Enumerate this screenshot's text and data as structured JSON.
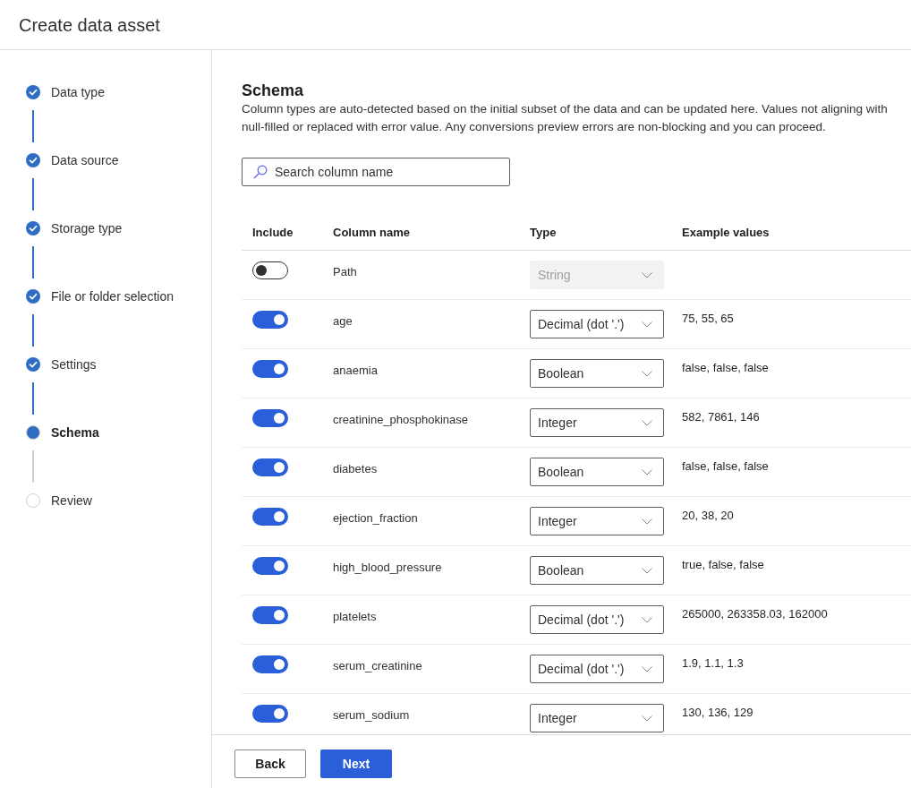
{
  "header": {
    "title": "Create data asset"
  },
  "steps": [
    {
      "label": "Data type",
      "completed": true,
      "selected": false
    },
    {
      "label": "Data source",
      "completed": true,
      "selected": false
    },
    {
      "label": "Storage type",
      "completed": true,
      "selected": false
    },
    {
      "label": "File or folder selection",
      "completed": true,
      "selected": false
    },
    {
      "label": "Settings",
      "completed": true,
      "selected": false
    },
    {
      "label": "Schema",
      "completed": false,
      "selected": true
    },
    {
      "label": "Review",
      "completed": false,
      "selected": false
    }
  ],
  "schema": {
    "title": "Schema",
    "description_lines": [
      "Column types are auto-detected based on the initial subset of the data and can be updated here. Values not aligning with",
      "null-filled or replaced with error value. Any conversions preview errors are non-blocking and you can proceed."
    ],
    "search": {
      "placeholder": "Search column name"
    }
  },
  "table": {
    "columns": [
      "Include",
      "Column name",
      "Type",
      "Example values"
    ],
    "rows": [
      {
        "included": false,
        "name": "Path",
        "type": "String",
        "type_disabled": true
      },
      {
        "included": true,
        "name": "age",
        "type": "Decimal (dot '.')",
        "type_disabled": false,
        "examples": "75, 55, 65"
      },
      {
        "included": true,
        "name": "anaemia",
        "type": "Boolean",
        "type_disabled": false,
        "examples": "false, false, false"
      },
      {
        "included": true,
        "name": "creatinine_phosphokinase",
        "type": "Integer",
        "type_disabled": false,
        "examples": "582, 7861, 146"
      },
      {
        "included": true,
        "name": "diabetes",
        "type": "Boolean",
        "type_disabled": false,
        "examples": "false, false, false"
      },
      {
        "included": true,
        "name": "ejection_fraction",
        "type": "Integer",
        "type_disabled": false,
        "examples": "20, 38, 20"
      },
      {
        "included": true,
        "name": "high_blood_pressure",
        "type": "Boolean",
        "type_disabled": false,
        "examples": "true, false, false"
      },
      {
        "included": true,
        "name": "platelets",
        "type": "Decimal (dot '.')",
        "type_disabled": false,
        "examples": "265000, 263358.03, 162000"
      },
      {
        "included": true,
        "name": "serum_creatinine",
        "type": "Decimal (dot '.')",
        "type_disabled": false,
        "examples": "1.9, 1.1, 1.3"
      },
      {
        "included": true,
        "name": "serum_sodium",
        "type": "Integer",
        "type_disabled": false,
        "examples": "130, 136, 129"
      }
    ]
  },
  "footer": {
    "buttons": [
      {
        "label": "Back",
        "kind": "secondary"
      },
      {
        "label": "Next",
        "kind": "primary"
      }
    ]
  }
}
